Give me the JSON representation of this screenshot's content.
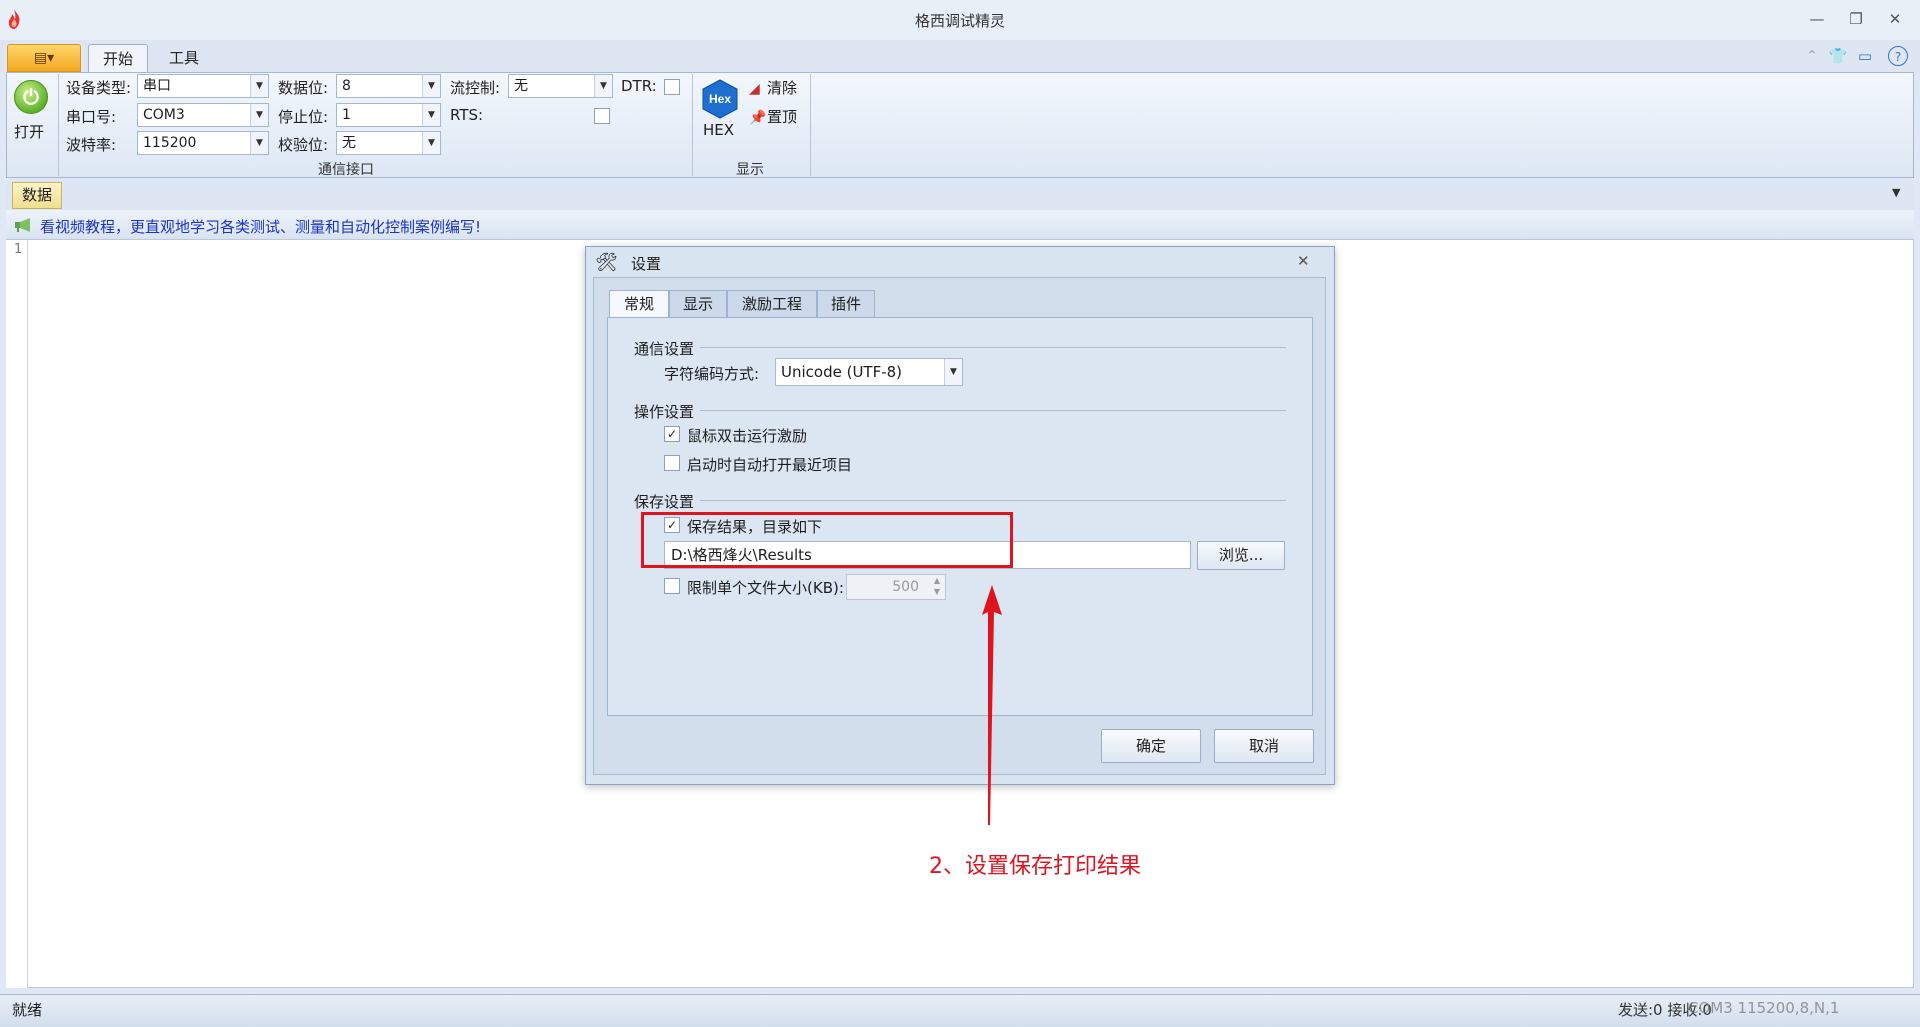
{
  "window": {
    "title": "格西调试精灵"
  },
  "ribbon": {
    "tabs": [
      "开始",
      "工具"
    ],
    "open_button_label": "打开",
    "fields": {
      "device_type_label": "设备类型:",
      "device_type_value": "串口",
      "port_label": "串口号:",
      "port_value": "COM3",
      "baud_label": "波特率:",
      "baud_value": "115200",
      "data_bits_label": "数据位:",
      "data_bits_value": "8",
      "stop_bits_label": "停止位:",
      "stop_bits_value": "1",
      "parity_label": "校验位:",
      "parity_value": "无",
      "flow_label": "流控制:",
      "flow_value": "无",
      "dtr_label": "DTR:",
      "rts_label": "RTS:"
    },
    "group_comm_label": "通信接口",
    "hex_label": "HEX",
    "hex_icon_text": "Hex",
    "clear_label": "清除",
    "pin_label": "置顶",
    "group_display_label": "显示"
  },
  "doc": {
    "tab_label": "数据"
  },
  "banner": {
    "text": "看视频教程，更直观地学习各类测试、测量和自动化控制案例编写!"
  },
  "editor": {
    "line_number": "1"
  },
  "dialog": {
    "title": "设置",
    "tabs": [
      "常规",
      "显示",
      "激励工程",
      "插件"
    ],
    "comm_section": "通信设置",
    "encoding_label": "字符编码方式:",
    "encoding_value": "Unicode (UTF-8)",
    "op_section": "操作设置",
    "dblclick_label": "鼠标双击运行激励",
    "dblclick_checked": true,
    "autoopen_label": "启动时自动打开最近项目",
    "autoopen_checked": false,
    "save_section": "保存设置",
    "save_results_label": "保存结果，目录如下",
    "save_results_checked": true,
    "path_value": "D:\\格西烽火\\Results",
    "browse_label": "浏览...",
    "limit_label": "限制单个文件大小(KB):",
    "limit_checked": false,
    "limit_value": "500",
    "ok_label": "确定",
    "cancel_label": "取消"
  },
  "annotation": {
    "text": "2、设置保存打印结果",
    "color": "#e0141e"
  },
  "status": {
    "ready": "就绪",
    "right": "发送:0 接收:0",
    "overlay": "COM3 115200,8,N,1"
  },
  "colors": {
    "accent": "#f4a922",
    "link": "#1a33c8"
  }
}
